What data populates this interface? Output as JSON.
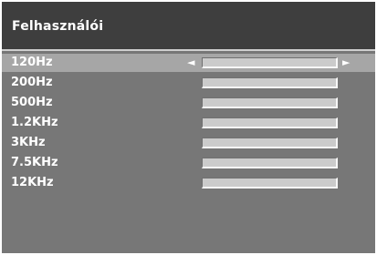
{
  "menu": {
    "title": "Felhasználói"
  },
  "equalizer": {
    "bands": [
      {
        "label": "120Hz",
        "selected": true
      },
      {
        "label": "200Hz",
        "selected": false
      },
      {
        "label": "500Hz",
        "selected": false
      },
      {
        "label": "1.2KHz",
        "selected": false
      },
      {
        "label": "3KHz",
        "selected": false
      },
      {
        "label": "7.5KHz",
        "selected": false
      },
      {
        "label": "12KHz",
        "selected": false
      }
    ],
    "arrows": {
      "left": "◄",
      "right": "►"
    }
  },
  "colors": {
    "title_bar": "#3e3e3e",
    "panel": "#777777",
    "selected_row": "#a6a6a6",
    "slider_track": "#cbcbcb",
    "text": "#ffffff"
  }
}
